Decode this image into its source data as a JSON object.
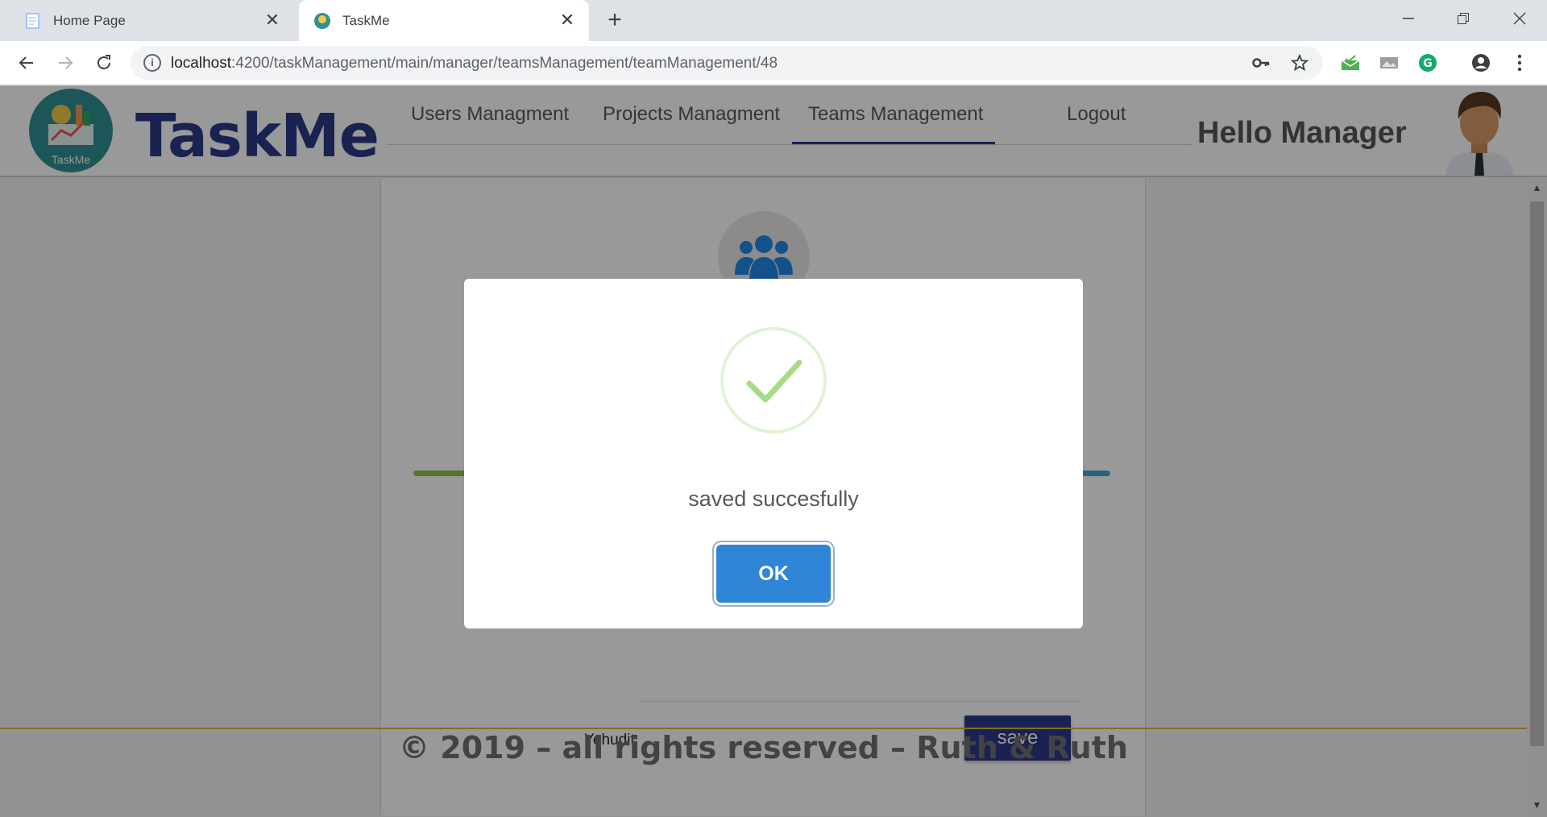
{
  "browser": {
    "tabs": [
      {
        "title": "Home Page"
      },
      {
        "title": "TaskMe"
      }
    ],
    "url_host": "localhost",
    "url_path": ":4200/taskManagement/main/manager/teamsManagement/teamManagement/48"
  },
  "app": {
    "brand": "TaskMe",
    "logo_text": "TaskMe",
    "nav": [
      {
        "label": "Users Managment"
      },
      {
        "label": "Projects Managment"
      },
      {
        "label": "Teams Management"
      },
      {
        "label": "Logout"
      }
    ],
    "active_nav": "Teams Management",
    "greeting": "Hello Manager"
  },
  "content": {
    "member_name": "Yehudit",
    "save_label": "save"
  },
  "footer": {
    "text": "© 2019 – all rights reserved – Ruth & Ruth"
  },
  "modal": {
    "message": "saved succesfully",
    "ok_label": "OK"
  },
  "colors": {
    "brand": "#2c3a88",
    "success": "#a5dc86",
    "ok_button": "#3085d6",
    "footer_line": "#e0b43a"
  }
}
